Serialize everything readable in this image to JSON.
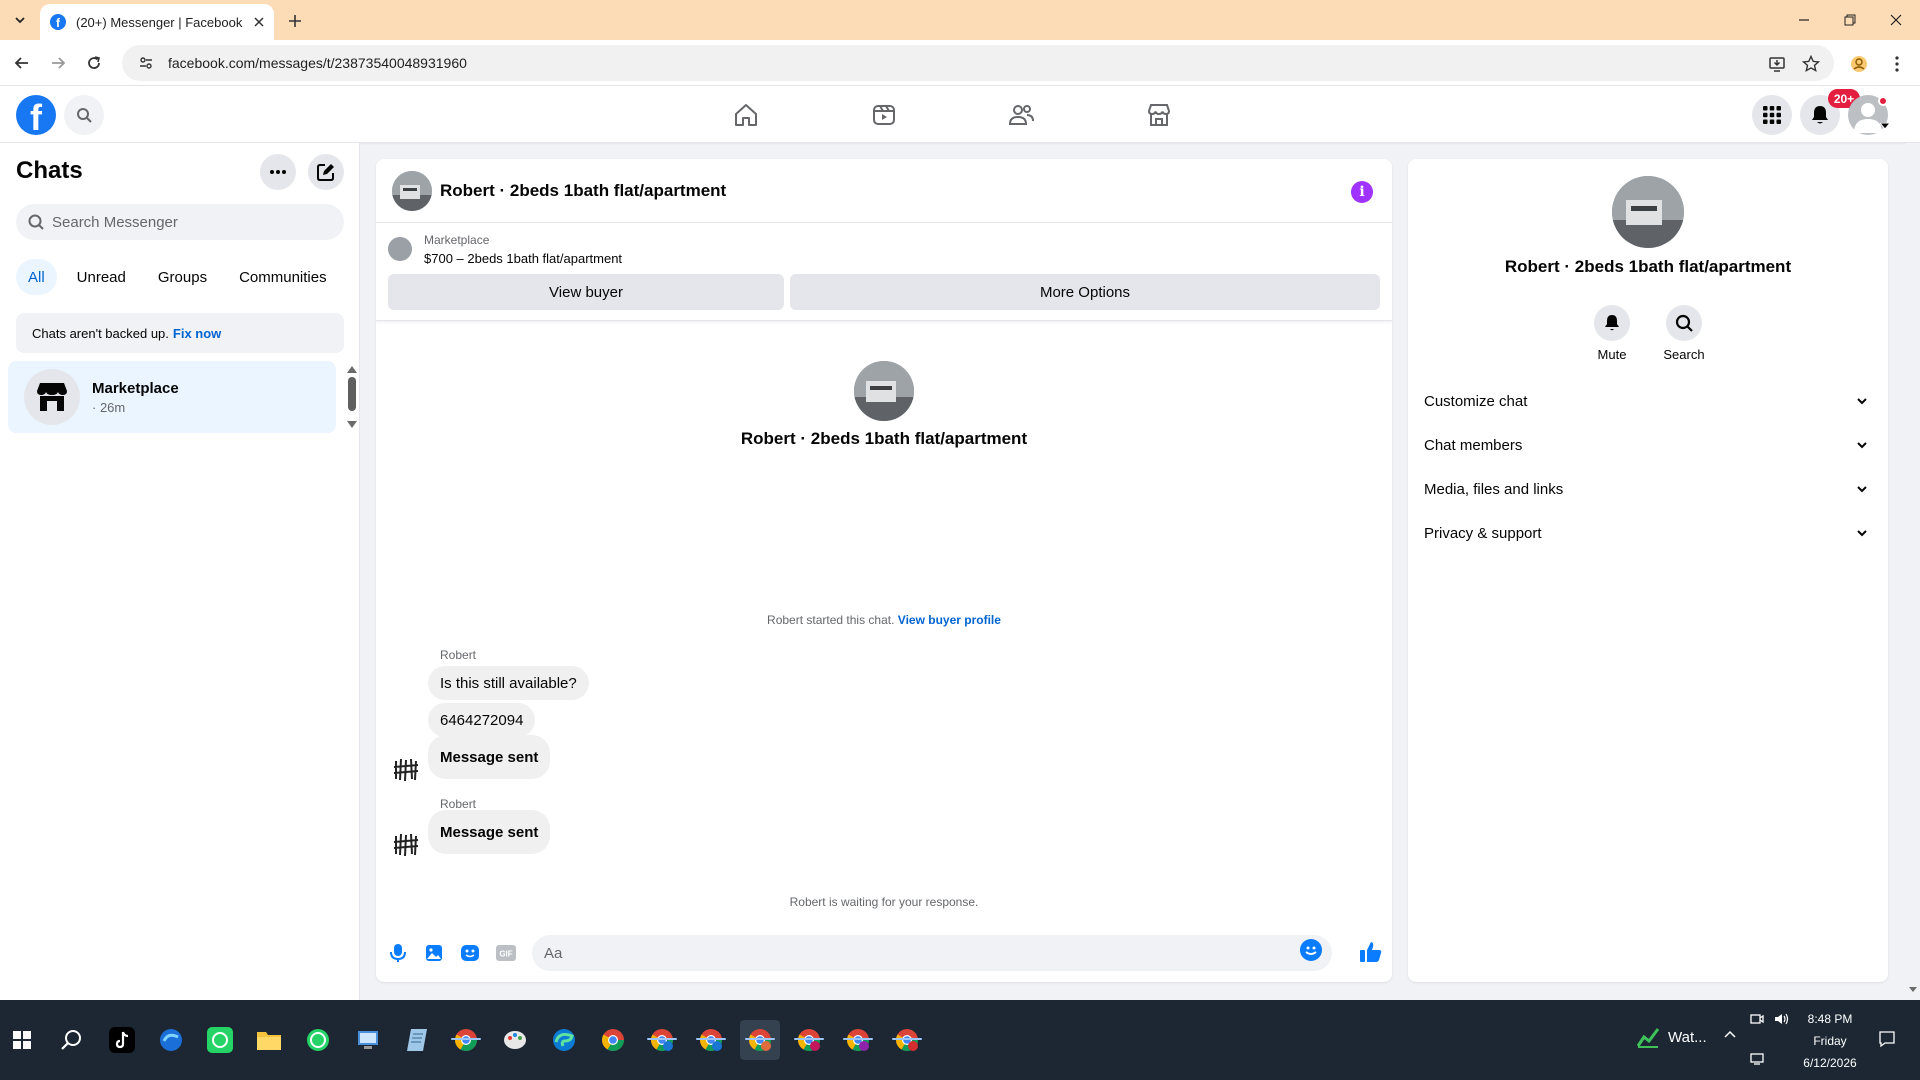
{
  "browser": {
    "tab_title": "(20+) Messenger | Facebook",
    "url": "facebook.com/messages/t/23873540048931960"
  },
  "header": {
    "notification_badge": "20+"
  },
  "chats_panel": {
    "title": "Chats",
    "search_placeholder": "Search Messenger",
    "filters": [
      "All",
      "Unread",
      "Groups",
      "Communities"
    ],
    "active_filter": "All",
    "backup_note": "Chats aren't backed up.",
    "backup_link": "Fix now",
    "chat_list": [
      {
        "name": "Marketplace",
        "meta": "· 26m"
      }
    ]
  },
  "conversation": {
    "title": "Robert · 2beds 1bath flat/apartment",
    "marketplace_label": "Marketplace",
    "listing": "$700 – 2beds 1bath flat/apartment",
    "view_buyer_button": "View buyer",
    "more_options_button": "More Options",
    "intro_name": "Robert · 2beds 1bath flat/apartment",
    "started_text": "Robert started this chat.",
    "started_link": "View buyer profile",
    "messages": [
      {
        "sender": "Robert",
        "text": "Is this still available?"
      },
      {
        "sender": "",
        "text": "6464272094"
      },
      {
        "sender": "",
        "text": "Message sent"
      },
      {
        "sender": "Robert",
        "text": "Message sent"
      }
    ],
    "waiting_text": "Robert is waiting for your response.",
    "composer_placeholder": "Aa"
  },
  "info_panel": {
    "name": "Robert · 2beds 1bath flat/apartment",
    "actions": [
      "Mute",
      "Search"
    ],
    "sections": [
      "Customize chat",
      "Chat members",
      "Media, files and links",
      "Privacy & support"
    ]
  },
  "taskbar": {
    "weather_label": "Wat...",
    "time": "8:48 PM",
    "day": "Friday",
    "date": "6/12/2026"
  },
  "colors": {
    "accent": "#0064d1",
    "facebook_blue": "#1877f2",
    "info_purple": "#a033ff",
    "badge_red": "#e41e3f",
    "tab_strip": "#fcdcb7"
  }
}
